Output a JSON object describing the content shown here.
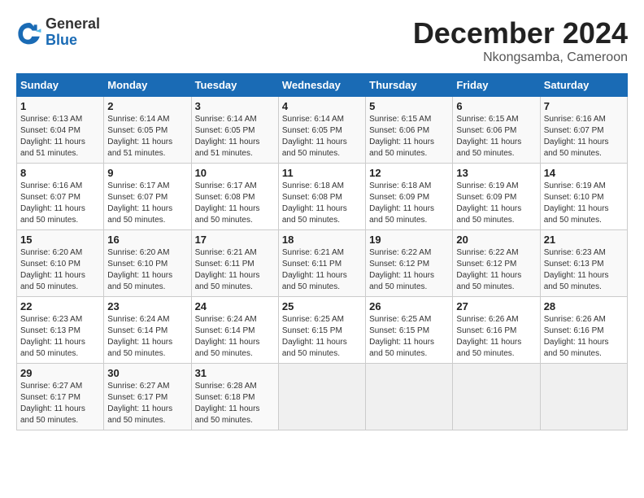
{
  "logo": {
    "general": "General",
    "blue": "Blue"
  },
  "title": "December 2024",
  "location": "Nkongsamba, Cameroon",
  "weekdays": [
    "Sunday",
    "Monday",
    "Tuesday",
    "Wednesday",
    "Thursday",
    "Friday",
    "Saturday"
  ],
  "weeks": [
    [
      {
        "day": "1",
        "sunrise": "6:13 AM",
        "sunset": "6:04 PM",
        "daylight": "11 hours and 51 minutes."
      },
      {
        "day": "2",
        "sunrise": "6:14 AM",
        "sunset": "6:05 PM",
        "daylight": "11 hours and 51 minutes."
      },
      {
        "day": "3",
        "sunrise": "6:14 AM",
        "sunset": "6:05 PM",
        "daylight": "11 hours and 51 minutes."
      },
      {
        "day": "4",
        "sunrise": "6:14 AM",
        "sunset": "6:05 PM",
        "daylight": "11 hours and 50 minutes."
      },
      {
        "day": "5",
        "sunrise": "6:15 AM",
        "sunset": "6:06 PM",
        "daylight": "11 hours and 50 minutes."
      },
      {
        "day": "6",
        "sunrise": "6:15 AM",
        "sunset": "6:06 PM",
        "daylight": "11 hours and 50 minutes."
      },
      {
        "day": "7",
        "sunrise": "6:16 AM",
        "sunset": "6:07 PM",
        "daylight": "11 hours and 50 minutes."
      }
    ],
    [
      {
        "day": "8",
        "sunrise": "6:16 AM",
        "sunset": "6:07 PM",
        "daylight": "11 hours and 50 minutes."
      },
      {
        "day": "9",
        "sunrise": "6:17 AM",
        "sunset": "6:07 PM",
        "daylight": "11 hours and 50 minutes."
      },
      {
        "day": "10",
        "sunrise": "6:17 AM",
        "sunset": "6:08 PM",
        "daylight": "11 hours and 50 minutes."
      },
      {
        "day": "11",
        "sunrise": "6:18 AM",
        "sunset": "6:08 PM",
        "daylight": "11 hours and 50 minutes."
      },
      {
        "day": "12",
        "sunrise": "6:18 AM",
        "sunset": "6:09 PM",
        "daylight": "11 hours and 50 minutes."
      },
      {
        "day": "13",
        "sunrise": "6:19 AM",
        "sunset": "6:09 PM",
        "daylight": "11 hours and 50 minutes."
      },
      {
        "day": "14",
        "sunrise": "6:19 AM",
        "sunset": "6:10 PM",
        "daylight": "11 hours and 50 minutes."
      }
    ],
    [
      {
        "day": "15",
        "sunrise": "6:20 AM",
        "sunset": "6:10 PM",
        "daylight": "11 hours and 50 minutes."
      },
      {
        "day": "16",
        "sunrise": "6:20 AM",
        "sunset": "6:10 PM",
        "daylight": "11 hours and 50 minutes."
      },
      {
        "day": "17",
        "sunrise": "6:21 AM",
        "sunset": "6:11 PM",
        "daylight": "11 hours and 50 minutes."
      },
      {
        "day": "18",
        "sunrise": "6:21 AM",
        "sunset": "6:11 PM",
        "daylight": "11 hours and 50 minutes."
      },
      {
        "day": "19",
        "sunrise": "6:22 AM",
        "sunset": "6:12 PM",
        "daylight": "11 hours and 50 minutes."
      },
      {
        "day": "20",
        "sunrise": "6:22 AM",
        "sunset": "6:12 PM",
        "daylight": "11 hours and 50 minutes."
      },
      {
        "day": "21",
        "sunrise": "6:23 AM",
        "sunset": "6:13 PM",
        "daylight": "11 hours and 50 minutes."
      }
    ],
    [
      {
        "day": "22",
        "sunrise": "6:23 AM",
        "sunset": "6:13 PM",
        "daylight": "11 hours and 50 minutes."
      },
      {
        "day": "23",
        "sunrise": "6:24 AM",
        "sunset": "6:14 PM",
        "daylight": "11 hours and 50 minutes."
      },
      {
        "day": "24",
        "sunrise": "6:24 AM",
        "sunset": "6:14 PM",
        "daylight": "11 hours and 50 minutes."
      },
      {
        "day": "25",
        "sunrise": "6:25 AM",
        "sunset": "6:15 PM",
        "daylight": "11 hours and 50 minutes."
      },
      {
        "day": "26",
        "sunrise": "6:25 AM",
        "sunset": "6:15 PM",
        "daylight": "11 hours and 50 minutes."
      },
      {
        "day": "27",
        "sunrise": "6:26 AM",
        "sunset": "6:16 PM",
        "daylight": "11 hours and 50 minutes."
      },
      {
        "day": "28",
        "sunrise": "6:26 AM",
        "sunset": "6:16 PM",
        "daylight": "11 hours and 50 minutes."
      }
    ],
    [
      {
        "day": "29",
        "sunrise": "6:27 AM",
        "sunset": "6:17 PM",
        "daylight": "11 hours and 50 minutes."
      },
      {
        "day": "30",
        "sunrise": "6:27 AM",
        "sunset": "6:17 PM",
        "daylight": "11 hours and 50 minutes."
      },
      {
        "day": "31",
        "sunrise": "6:28 AM",
        "sunset": "6:18 PM",
        "daylight": "11 hours and 50 minutes."
      },
      null,
      null,
      null,
      null
    ]
  ]
}
